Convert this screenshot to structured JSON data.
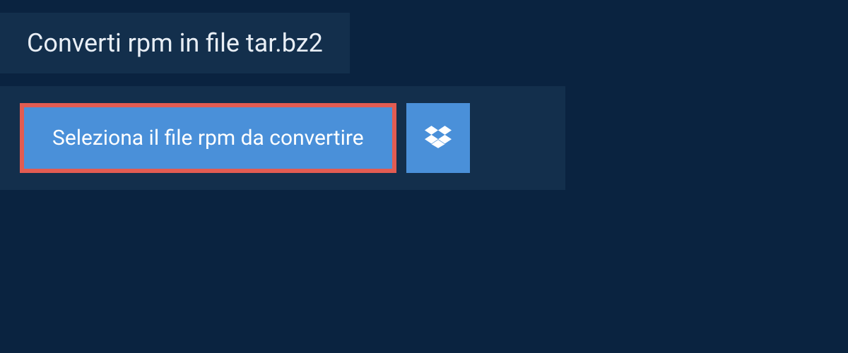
{
  "header": {
    "title": "Converti rpm in file tar.bz2"
  },
  "upload": {
    "select_label": "Seleziona il file rpm da convertire"
  }
}
